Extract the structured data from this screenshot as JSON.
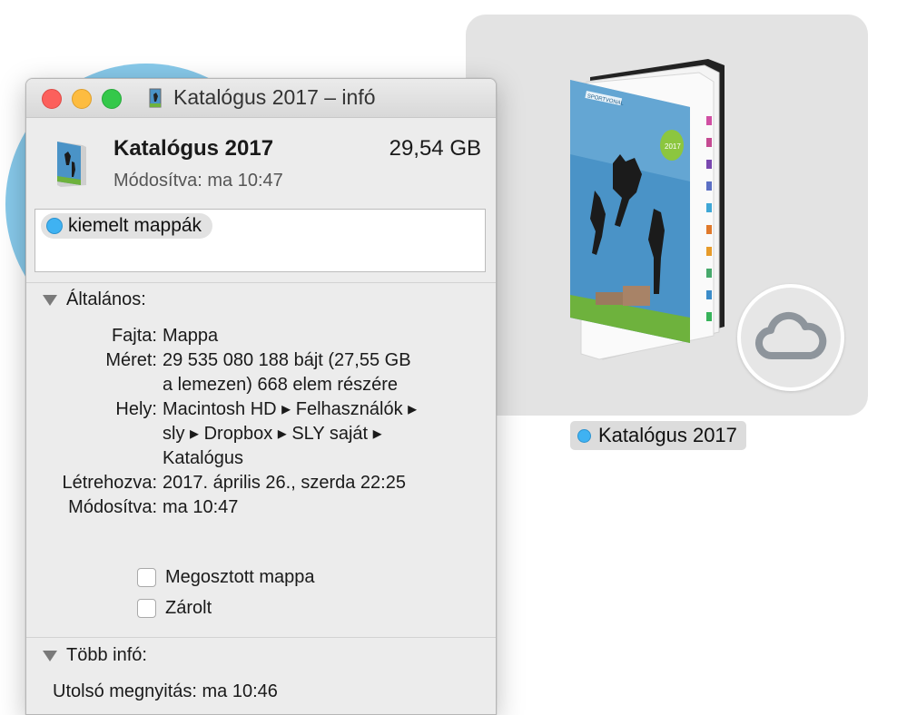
{
  "window": {
    "title": "Katalógus 2017 – infó",
    "item_name": "Katalógus 2017",
    "item_size": "29,54 GB",
    "modified_line": "Módosítva:  ma 10:47",
    "tags": [
      "kiemelt mappák"
    ]
  },
  "general": {
    "header": "Általános:",
    "rows": [
      {
        "key": "Fajta:",
        "value": "Mappa"
      },
      {
        "key": "Méret:",
        "value": "29 535 080 188 bájt (27,55 GB"
      },
      {
        "key": "",
        "value": "a lemezen) 668 elem részére"
      },
      {
        "key": "Hely:",
        "value": "Macintosh HD ▸ Felhasználók ▸"
      },
      {
        "key": "",
        "value": "sly ▸ Dropbox ▸ SLY saját ▸"
      },
      {
        "key": "",
        "value": "Katalógus"
      },
      {
        "key": "Létrehozva:",
        "value": "2017. április 26., szerda 22:25"
      },
      {
        "key": "Módosítva:",
        "value": "ma 10:47"
      }
    ],
    "shared_folder_label": "Megosztott mappa",
    "locked_label": "Zárolt"
  },
  "more_info": {
    "header": "Több infó:",
    "last_opened": "Utolsó megnyitás: ma 10:46"
  },
  "desktop_icon": {
    "label": "Katalógus 2017",
    "tag_color": "#3fb2f2",
    "book_cover_badge": "2017",
    "book_header": "SPORTVONAL",
    "badge_icon": "cloud-icon"
  },
  "colors": {
    "close": "#fc605c",
    "minimize": "#fdbc40",
    "maximize": "#34c84a",
    "tag_blue": "#3fb2f2"
  }
}
